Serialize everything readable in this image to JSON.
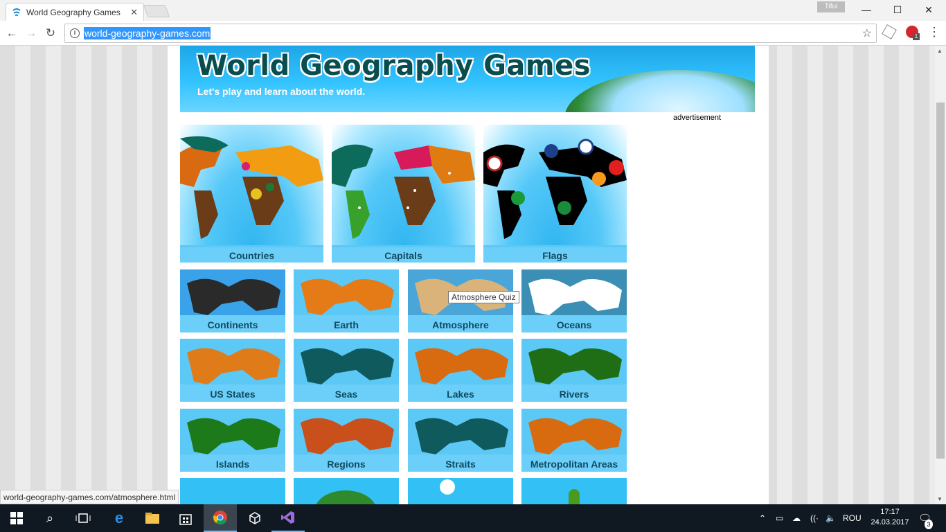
{
  "browser": {
    "tab_title": "World Geography Games",
    "tab_close": "✕",
    "profile_name": "Tifui",
    "url": "world-geography-games.com",
    "status_url": "world-geography-games.com/atmosphere.html",
    "window_buttons": {
      "minimize": "—",
      "maximize": "☐",
      "close": "✕"
    }
  },
  "banner": {
    "title": "World Geography Games",
    "subtitle": "Let's play and learn about the world.",
    "ad_label": "advertisement"
  },
  "games_big": [
    {
      "label": "Countries",
      "icon": "political-world-map"
    },
    {
      "label": "Capitals",
      "icon": "capitals-world-map"
    },
    {
      "label": "Flags",
      "icon": "flags-world-map"
    }
  ],
  "games_small": [
    {
      "label": "Continents",
      "icon": "continents-map",
      "color": "#2a2a2a",
      "bg": "#3aa2e8"
    },
    {
      "label": "Earth",
      "icon": "earth-layers",
      "color": "#e57b16",
      "bg": "#5bc8f5"
    },
    {
      "label": "Atmosphere",
      "icon": "hot-air-balloon",
      "color": "#d9b37a",
      "bg": "#4aa6d8"
    },
    {
      "label": "Oceans",
      "icon": "ocean-map",
      "color": "#ffffff",
      "bg": "#3b8eb4"
    },
    {
      "label": "US States",
      "icon": "us-states-map",
      "color": "#e07b1a",
      "bg": "#5bc8f5"
    },
    {
      "label": "Seas",
      "icon": "seas-map",
      "color": "#0f5a5c",
      "bg": "#5bc8f5"
    },
    {
      "label": "Lakes",
      "icon": "lakes-map",
      "color": "#d86a10",
      "bg": "#5bc8f5"
    },
    {
      "label": "Rivers",
      "icon": "rivers-map",
      "color": "#1f6e16",
      "bg": "#5bc8f5"
    },
    {
      "label": "Islands",
      "icon": "islands-map",
      "color": "#1c7a1a",
      "bg": "#5bc8f5"
    },
    {
      "label": "Regions",
      "icon": "regions-map",
      "color": "#c9501a",
      "bg": "#5bc8f5"
    },
    {
      "label": "Straits",
      "icon": "straits-map",
      "color": "#0f5a5c",
      "bg": "#5bc8f5"
    },
    {
      "label": "Metropolitan Areas",
      "icon": "metropolitan-map",
      "color": "#d86a10",
      "bg": "#5bc8f5"
    }
  ],
  "tooltip": "Atmosphere Quiz",
  "taskbar": {
    "language": "ROU",
    "time": "17:17",
    "date": "24.03.2017",
    "notifications": "3"
  }
}
